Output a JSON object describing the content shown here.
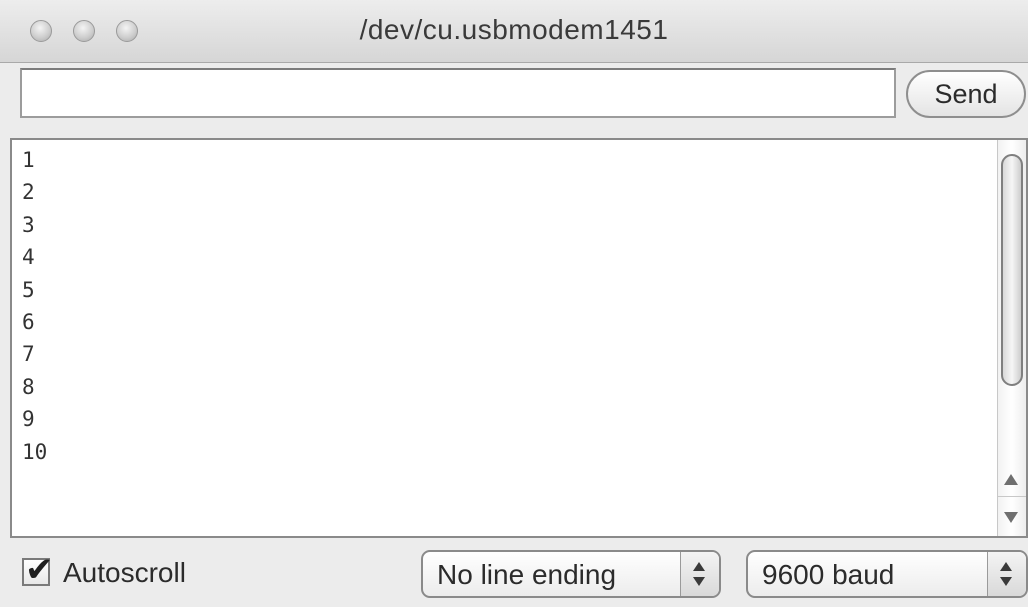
{
  "window": {
    "title": "/dev/cu.usbmodem1451"
  },
  "send_bar": {
    "input_value": "",
    "input_placeholder": "",
    "send_label": "Send"
  },
  "output": {
    "lines": [
      "1",
      "2",
      "3",
      "4",
      "5",
      "6",
      "7",
      "8",
      "9",
      "10"
    ]
  },
  "footer": {
    "autoscroll_label": "Autoscroll",
    "autoscroll_checked": true,
    "line_ending_selected": "No line ending",
    "baud_selected": "9600 baud"
  },
  "icons": {
    "checkmark": "checkmark-icon",
    "scroll_up": "arrow-up-icon",
    "scroll_down": "arrow-down-icon"
  }
}
